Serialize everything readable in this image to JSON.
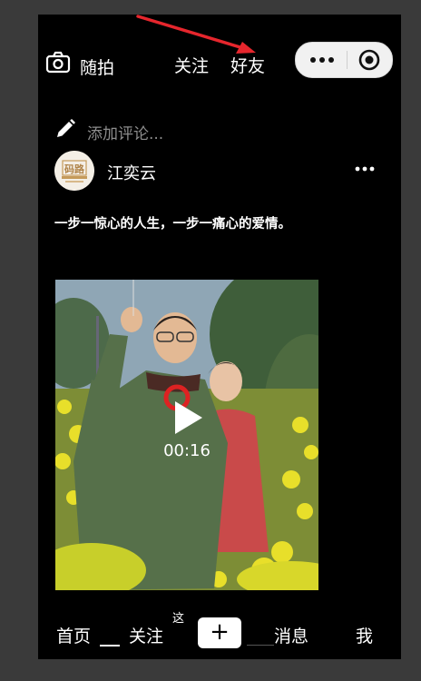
{
  "topbar": {
    "camera_icon": "camera-icon",
    "randshot_label": "随拍",
    "tabs": [
      {
        "label": "关注"
      },
      {
        "label": "好友"
      }
    ],
    "capsule": {
      "more_icon": "more-dots-icon",
      "close_icon": "target-circle-icon"
    },
    "annotation_color": "#e6262d"
  },
  "comment": {
    "icon": "pencil-icon",
    "placeholder": "添加评论..."
  },
  "post": {
    "author": {
      "name": "江奕云",
      "avatar_text": "码路"
    },
    "more_icon": "more-horizontal-icon",
    "caption": "一步一惊心的人生，一步一痛心的爱情。",
    "video": {
      "duration": "00:16",
      "play_icon": "play-icon"
    }
  },
  "bottom_nav": {
    "items": [
      {
        "label": "首页"
      },
      {
        "label": "关注"
      },
      {
        "label": "+"
      },
      {
        "label": "消息"
      },
      {
        "label": "我"
      }
    ],
    "partial_text": "这"
  },
  "colors": {
    "background": "#000000",
    "frame": "#3a3a3a",
    "text": "#ffffff",
    "placeholder": "#8d8d8d"
  }
}
